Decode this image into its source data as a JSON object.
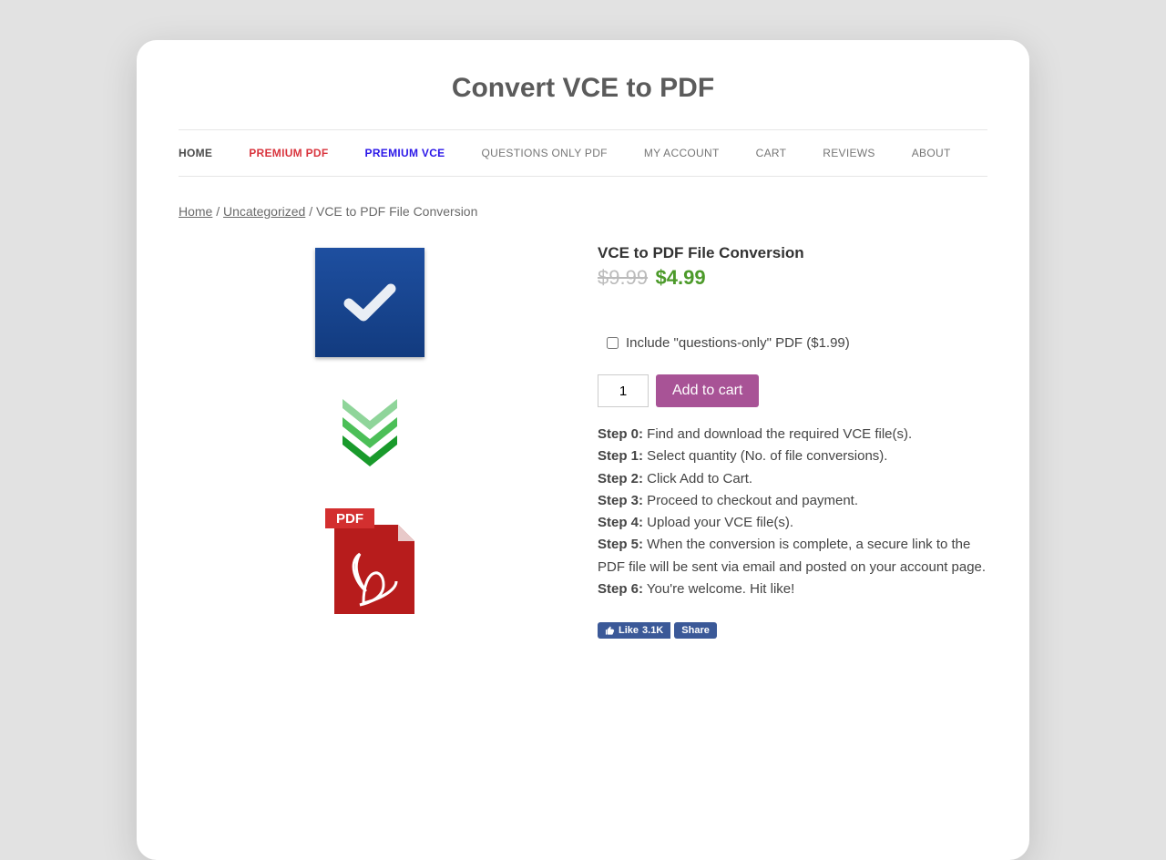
{
  "site_title": "Convert VCE to PDF",
  "nav": [
    {
      "label": "HOME",
      "style": "home"
    },
    {
      "label": "PREMIUM PDF",
      "style": "red"
    },
    {
      "label": "PREMIUM VCE",
      "style": "blue"
    },
    {
      "label": "QUESTIONS ONLY PDF",
      "style": ""
    },
    {
      "label": "MY ACCOUNT",
      "style": ""
    },
    {
      "label": "CART",
      "style": ""
    },
    {
      "label": "REVIEWS",
      "style": ""
    },
    {
      "label": "ABOUT",
      "style": ""
    }
  ],
  "breadcrumb": {
    "home": "Home",
    "cat": "Uncategorized",
    "current": "VCE to PDF File Conversion",
    "sep": " / "
  },
  "product": {
    "title": "VCE to PDF File Conversion",
    "old_price": "$9.99",
    "new_price": "$4.99",
    "addon_label": "Include \"questions-only\" PDF ($1.99)",
    "qty_value": "1",
    "add_to_cart": "Add to cart"
  },
  "steps": [
    {
      "label": "Step 0:",
      "text": " Find and download the required VCE file(s)."
    },
    {
      "label": "Step 1:",
      "text": " Select quantity (No. of file conversions)."
    },
    {
      "label": "Step 2:",
      "text": " Click Add to Cart."
    },
    {
      "label": "Step 3:",
      "text": " Proceed to checkout and payment."
    },
    {
      "label": "Step 4:",
      "text": " Upload your VCE file(s)."
    },
    {
      "label": "Step 5:",
      "text": " When the conversion is complete, a secure link to the PDF file will be sent via email and posted on your account page."
    },
    {
      "label": "Step 6:",
      "text": " You're welcome. Hit like!"
    }
  ],
  "fb": {
    "like": "Like",
    "count": "3.1K",
    "share": "Share"
  },
  "icons": {
    "pdf_label": "PDF"
  }
}
